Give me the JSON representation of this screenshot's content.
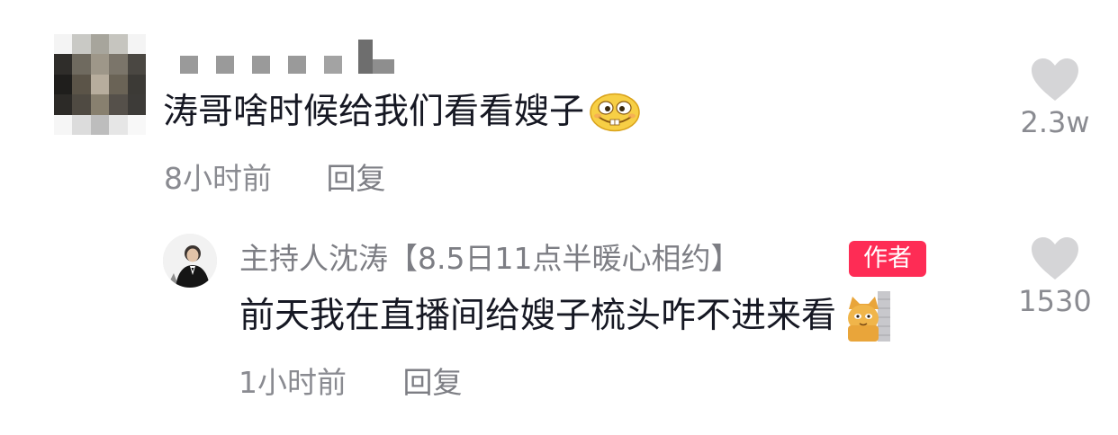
{
  "comment": {
    "text": "涛哥啥时候给我们看看嫂子",
    "emoji": "grin-emoji",
    "time": "8小时前",
    "reply_label": "回复",
    "like_count": "2.3w"
  },
  "reply": {
    "author_name": "主持人沈涛【8.5日11点半暖心相约】",
    "author_badge": "作者",
    "text": "前天我在直播间给嫂子梳头咋不进来看",
    "emoji": "cat-emoji",
    "time": "1小时前",
    "reply_label": "回复",
    "like_count": "1530"
  },
  "icons": {
    "like": "heart-icon"
  },
  "colors": {
    "text_primary": "#161823",
    "text_secondary": "#8a8b91",
    "heart": "#d5d5d7",
    "badge": "#fe2c55"
  }
}
